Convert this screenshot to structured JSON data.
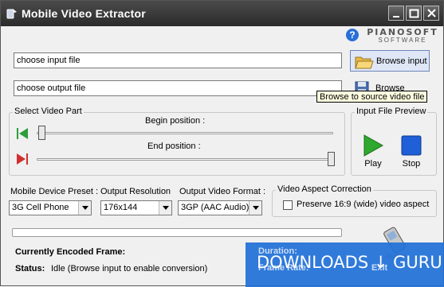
{
  "window": {
    "title": "Mobile Video Extractor",
    "icons": {
      "app": "app-logo-icon",
      "minimize": "minimize-icon",
      "maximize": "maximize-icon",
      "close": "close-icon"
    }
  },
  "brand": {
    "name": "PIANOSOFT",
    "sub": "SOFTWARE",
    "help_icon": "help-icon"
  },
  "inputs": {
    "input_file": "choose input file",
    "output_file": "choose output file"
  },
  "buttons": {
    "browse_input": "Browse input",
    "browse_output": "Browse output"
  },
  "tooltip": "Browse to source video file",
  "video_part": {
    "legend": "Select Video Part",
    "begin_label": "Begin position :",
    "end_label": "End position :",
    "begin_value": 0.0,
    "end_value": 1.0
  },
  "preview": {
    "legend": "Input File Preview",
    "play": "Play",
    "stop": "Stop"
  },
  "combos": {
    "preset_label": "Mobile Device Preset :",
    "preset_value": "3G Cell Phone",
    "resolution_label": "Output Resolution",
    "resolution_value": "176x144",
    "format_label": "Output Video Format :",
    "format_value": "3GP (AAC Audio)"
  },
  "aspect": {
    "legend": "Video Aspect Correction",
    "checkbox_label": "Preserve 16:9 (wide) video aspect",
    "checked": false
  },
  "progress": 0,
  "status": {
    "frame_label": "Currently Encoded Frame:",
    "status_label": "Status:",
    "status_value": "Idle (Browse input to enable conversion)",
    "duration_label": "Duration:",
    "frame_rate_label": "Frame Rate:",
    "exit_label": "Exit"
  },
  "watermark": "DOWNLOADS ↓ GURU",
  "colors": {
    "accent": "#2070d8",
    "play": "#2ea82e",
    "stop": "#1f5fd8",
    "marker_green": "#2e9e3a",
    "marker_red": "#d03030"
  }
}
